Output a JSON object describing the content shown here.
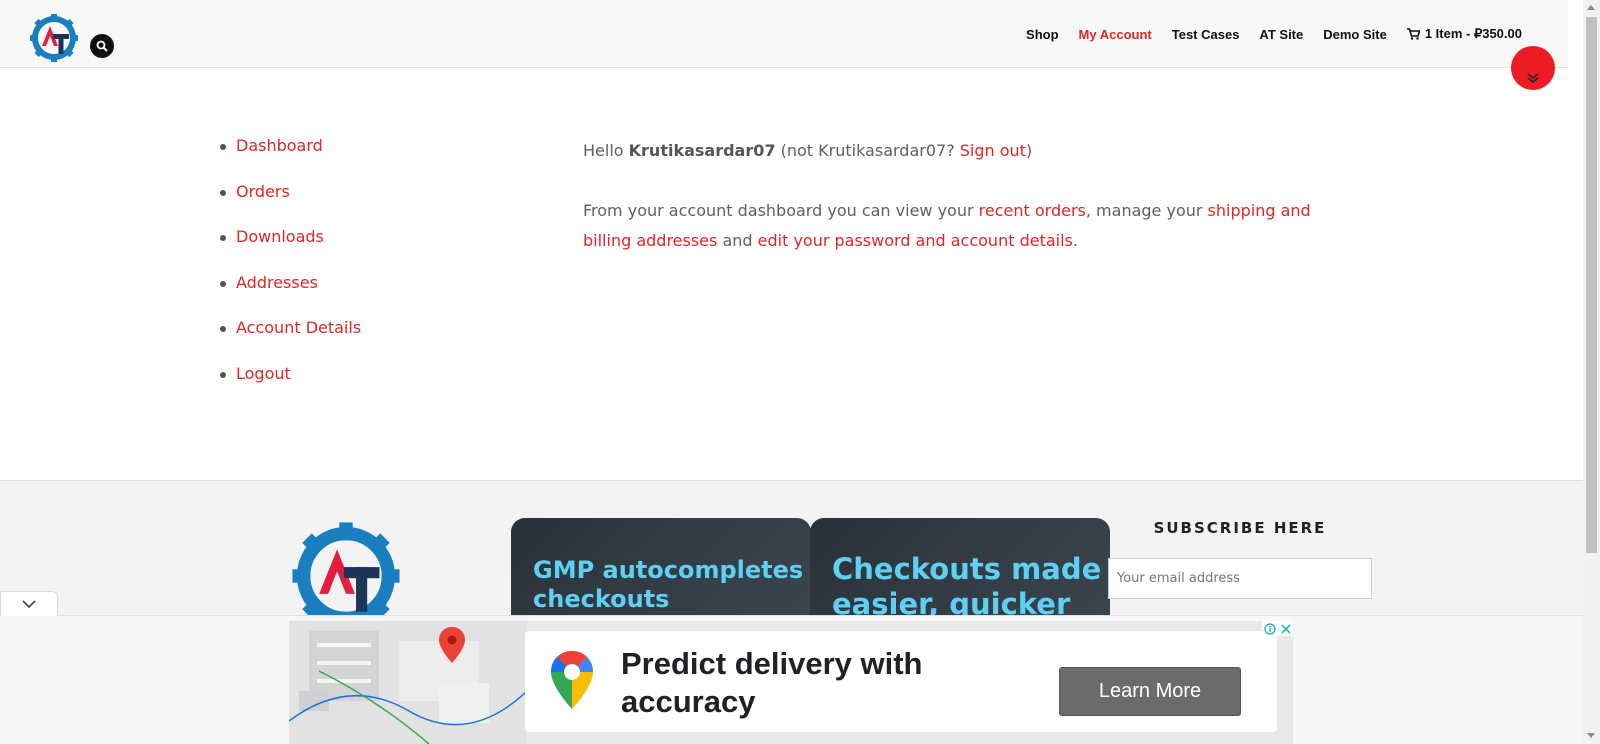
{
  "header": {
    "logo_alt": "AT",
    "nav": [
      {
        "label": "Shop"
      },
      {
        "label": "My Account"
      },
      {
        "label": "Test Cases"
      },
      {
        "label": "AT Site"
      },
      {
        "label": "Demo Site"
      }
    ],
    "cart_label": "1 Item - ₽350.00"
  },
  "account_nav": [
    {
      "label": "Dashboard"
    },
    {
      "label": "Orders"
    },
    {
      "label": "Downloads"
    },
    {
      "label": "Addresses"
    },
    {
      "label": "Account Details"
    },
    {
      "label": "Logout"
    }
  ],
  "content": {
    "hello": "Hello ",
    "username": "Krutikasardar07",
    "not_user": " (not Krutikasardar07? ",
    "sign_out": "Sign out",
    "close_paren": ")",
    "intro": "From your account dashboard you can view your ",
    "recent_orders": "recent orders",
    "manage": ", manage your ",
    "shipping_billing": "shipping and billing addresses",
    "and": " and ",
    "edit_password": "edit your password and account details",
    "period": "."
  },
  "footer": {
    "promo_1": "GMP autocompletes checkouts",
    "promo_2": "Checkouts made easier, quicker",
    "subscribe_title": "SUBSCRIBE HERE",
    "email_placeholder": "Your email address"
  },
  "ad": {
    "headline": "Predict delivery with accuracy",
    "cta": "Learn More"
  },
  "colors": {
    "accent": "#e02626",
    "fab": "#ed1c24",
    "promo_text": "#5ed0f4"
  }
}
